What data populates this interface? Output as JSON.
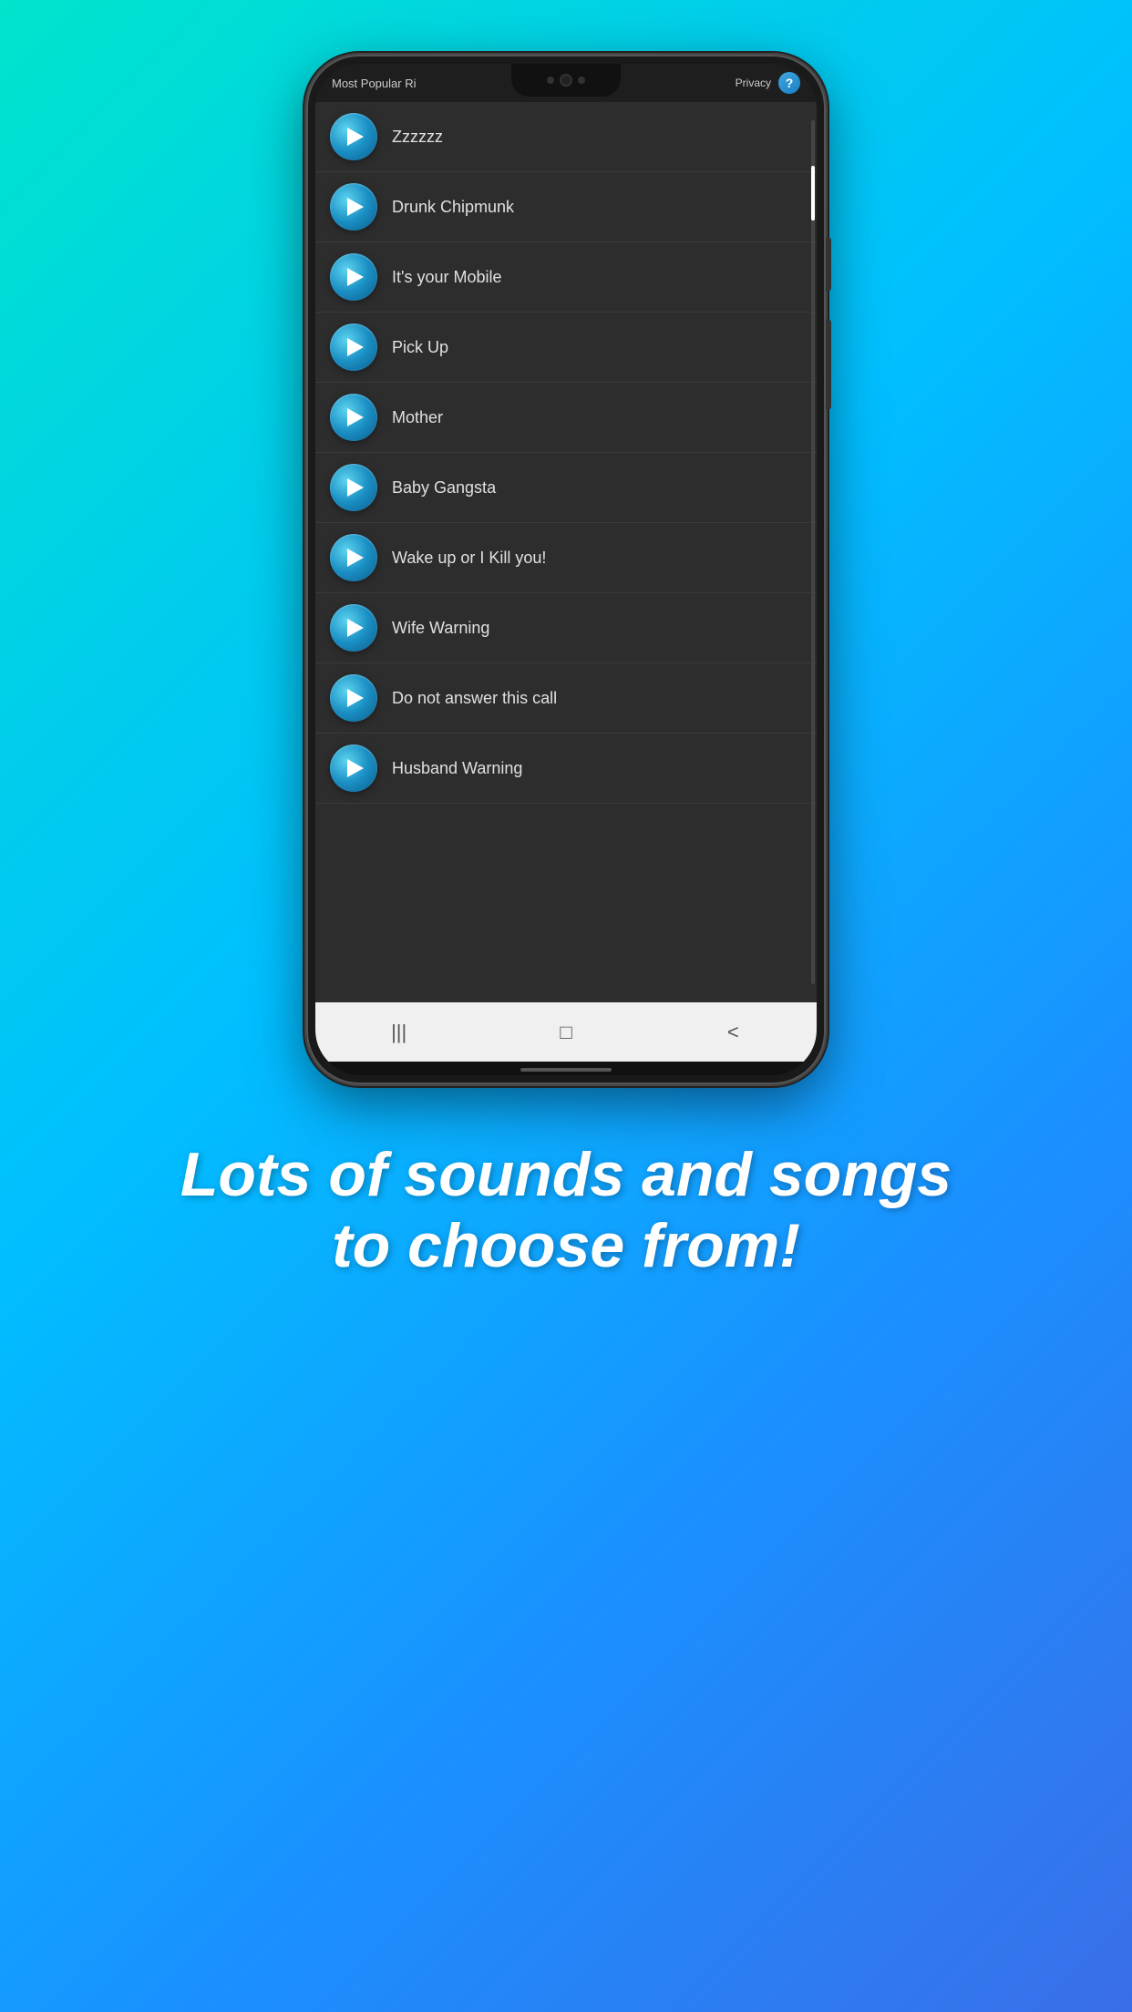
{
  "header": {
    "app_title": "Most Popular Ri",
    "privacy_label": "Privacy",
    "help_icon": "?"
  },
  "ringtones": [
    {
      "id": 1,
      "name": "Zzzzzz"
    },
    {
      "id": 2,
      "name": "Drunk Chipmunk"
    },
    {
      "id": 3,
      "name": "It's your Mobile"
    },
    {
      "id": 4,
      "name": "Pick Up"
    },
    {
      "id": 5,
      "name": "Mother"
    },
    {
      "id": 6,
      "name": "Baby Gangsta"
    },
    {
      "id": 7,
      "name": "Wake up or I Kill you!"
    },
    {
      "id": 8,
      "name": "Wife Warning"
    },
    {
      "id": 9,
      "name": "Do not answer this call"
    },
    {
      "id": 10,
      "name": "Husband Warning"
    }
  ],
  "nav": {
    "recent_icon": "|||",
    "home_icon": "□",
    "back_icon": "<"
  },
  "promo": {
    "line1": "Lots of sounds and songs",
    "line2": "to choose from!"
  }
}
